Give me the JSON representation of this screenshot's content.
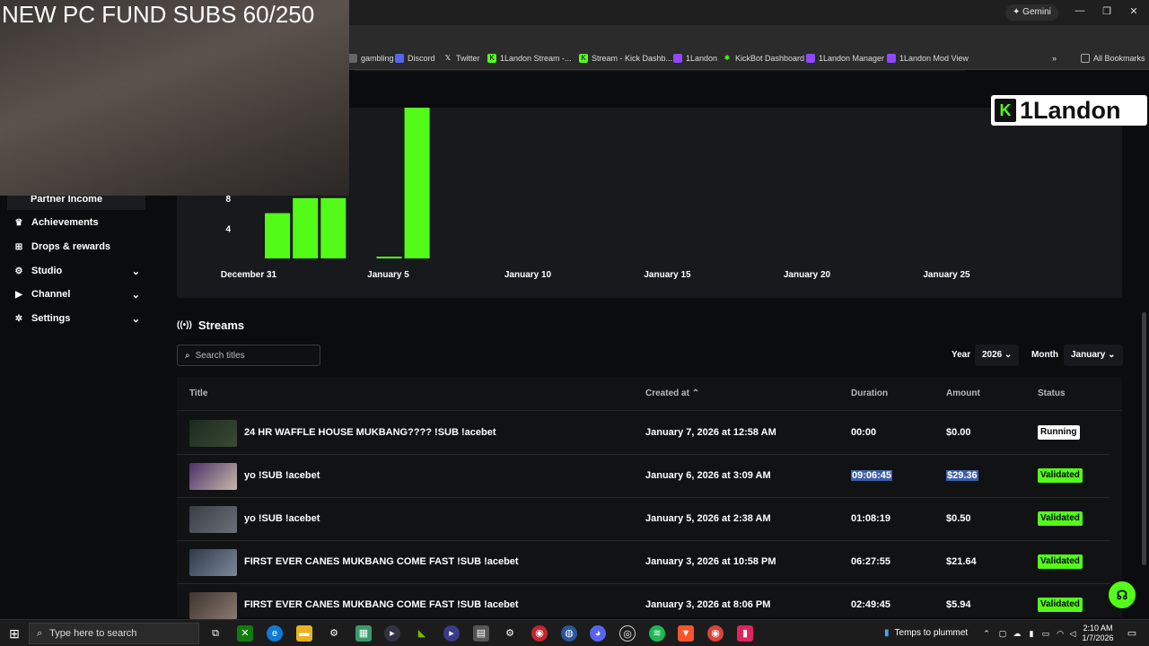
{
  "browser": {
    "gemini_label": "Gemini",
    "bookmarks": [
      {
        "label": "gambling",
        "icon": "bookmark-icon"
      },
      {
        "label": "Discord",
        "icon": "discord-icon"
      },
      {
        "label": "Twitter",
        "icon": "x-icon"
      },
      {
        "label": "1Landon Stream -...",
        "icon": "kick-icon"
      },
      {
        "label": "Stream - Kick Dashb...",
        "icon": "kick-icon"
      },
      {
        "label": "1Landon",
        "icon": "twitch-icon"
      },
      {
        "label": "KickBot Dashboard",
        "icon": "kickbot-icon"
      },
      {
        "label": "1Landon Manager",
        "icon": "twitch-icon"
      },
      {
        "label": "1Landon Mod View",
        "icon": "twitch-icon"
      }
    ],
    "all_bookmarks": "All Bookmarks"
  },
  "overlay": {
    "cam_title": "NEW PC FUND SUBS 60/250",
    "logo_text": "1Landon"
  },
  "sidebar": {
    "items": [
      {
        "label": "Partner Income",
        "icon": "",
        "active": true
      },
      {
        "label": "Achievements",
        "icon": "trophy-icon"
      },
      {
        "label": "Drops & rewards",
        "icon": "gift-icon"
      },
      {
        "label": "Studio",
        "icon": "gear-icon",
        "chevron": true
      },
      {
        "label": "Channel",
        "icon": "camera-icon",
        "chevron": true
      },
      {
        "label": "Settings",
        "icon": "gear-icon",
        "chevron": true
      }
    ]
  },
  "chart_data": {
    "type": "bar",
    "yticks": [
      4,
      8
    ],
    "xticks": [
      "December 31",
      "January 5",
      "January 10",
      "January 15",
      "January 20",
      "January 25"
    ],
    "ylim": [
      0,
      20
    ],
    "values": [
      {
        "date": "January 1",
        "value": 6
      },
      {
        "date": "January 2",
        "value": 8
      },
      {
        "date": "January 3",
        "value": 8
      },
      {
        "date": "January 5",
        "value": 0.2
      },
      {
        "date": "January 6",
        "value": 20
      }
    ],
    "bar_color": "#53fc18"
  },
  "streams": {
    "heading": "Streams",
    "search_placeholder": "Search titles",
    "year_label": "Year",
    "year_value": "2026",
    "month_label": "Month",
    "month_value": "January",
    "columns": {
      "title": "Title",
      "created": "Created at",
      "duration": "Duration",
      "amount": "Amount",
      "status": "Status"
    },
    "rows": [
      {
        "title": "24 HR WAFFLE HOUSE MUKBANG???? !SUB !acebet",
        "created": "January 7, 2026 at 12:58 AM",
        "duration": "00:00",
        "amount": "$0.00",
        "status": "Running"
      },
      {
        "title": "yo !SUB !acebet",
        "created": "January 6, 2026 at 3:09 AM",
        "duration": "09:06:45",
        "amount": "$29.36",
        "status": "Validated"
      },
      {
        "title": "yo !SUB !acebet",
        "created": "January 5, 2026 at 2:38 AM",
        "duration": "01:08:19",
        "amount": "$0.50",
        "status": "Validated"
      },
      {
        "title": "FIRST EVER CANES MUKBANG COME FAST !SUB !acebet",
        "created": "January 3, 2026 at 10:58 PM",
        "duration": "06:27:55",
        "amount": "$21.64",
        "status": "Validated"
      },
      {
        "title": "FIRST EVER CANES MUKBANG COME FAST !SUB !acebet",
        "created": "January 3, 2026 at 8:06 PM",
        "duration": "02:49:45",
        "amount": "$5.94",
        "status": "Validated"
      }
    ]
  },
  "taskbar": {
    "search_placeholder": "Type here to search",
    "weather": "Temps to plummet",
    "time": "2:10 AM",
    "date": "1/7/2026"
  }
}
